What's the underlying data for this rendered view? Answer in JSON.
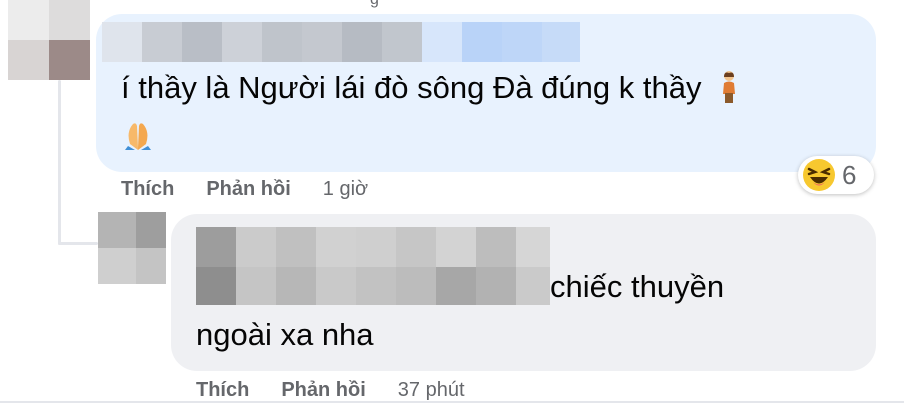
{
  "top_fragment": "g",
  "comment1": {
    "text_line1": "í thầy là Người lái đò sông Đà đúng k thầy",
    "actions": {
      "like": "Thích",
      "reply": "Phản hồi",
      "time": "1 giờ"
    },
    "reaction": {
      "icon": "laugh-emoji",
      "count": "6"
    },
    "icons": [
      "person-emoji",
      "folded-hands-emoji"
    ]
  },
  "comment2": {
    "text_line1_visible": "chiếc thuyền",
    "text_line2": "ngoài xa nha",
    "actions": {
      "like": "Thích",
      "reply": "Phản hồi",
      "time": "37 phút"
    }
  }
}
